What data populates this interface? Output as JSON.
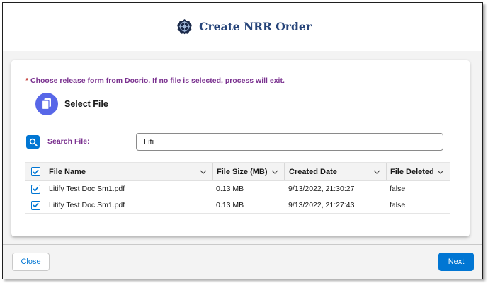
{
  "header": {
    "title": "Create NRR Order",
    "logo_icon": "dark-emblem-icon"
  },
  "message": {
    "required_marker": "*",
    "text": "Choose release form from Docrio. If no file is selected, process will exit."
  },
  "select_file": {
    "label": "Select File",
    "icon": "document-copy-icon"
  },
  "search": {
    "label": "Search File:",
    "value": "Liti",
    "icon": "search-icon"
  },
  "table": {
    "columns": [
      "File Name",
      "File Size (MB)",
      "Created Date",
      "File Deleted"
    ],
    "rows": [
      {
        "checked": true,
        "file_name": "Litify Test Doc Sm1.pdf",
        "file_size": "0.13 MB",
        "created_date": "9/13/2022, 21:30:27",
        "file_deleted": "false"
      },
      {
        "checked": true,
        "file_name": "Litify Test Doc Sm1.pdf",
        "file_size": "0.13 MB",
        "created_date": "9/13/2022, 21:27:43",
        "file_deleted": "false"
      }
    ]
  },
  "footer": {
    "close_label": "Close",
    "next_label": "Next"
  },
  "colors": {
    "brand_blue": "#0176d3",
    "title_navy": "#27457a",
    "label_purple": "#7a318f",
    "icon_indigo": "#5867e8"
  }
}
